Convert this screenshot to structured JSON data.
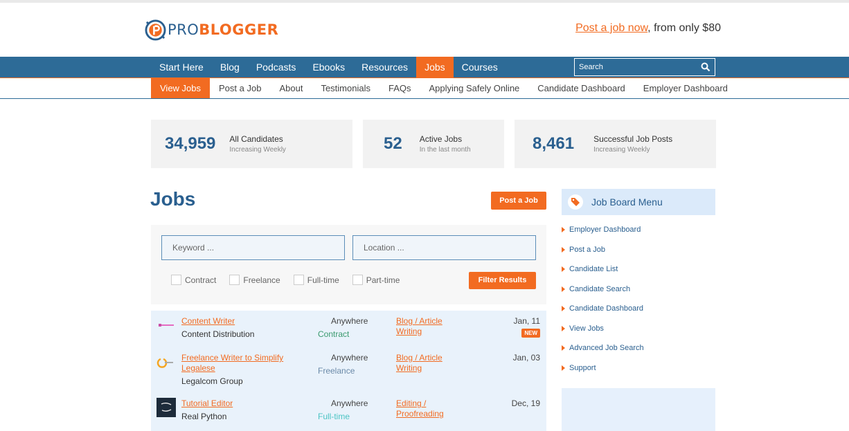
{
  "brand": {
    "logo_pro": "PRO",
    "logo_blogger": "BLOGGER",
    "colors": {
      "accent": "#f26b21",
      "primary": "#2d6b97",
      "heading": "#2a5f8f"
    }
  },
  "promo": {
    "link": "Post a job now",
    "rest": ", from only $80"
  },
  "nav": {
    "items": [
      {
        "label": "Start Here"
      },
      {
        "label": "Blog"
      },
      {
        "label": "Podcasts"
      },
      {
        "label": "Ebooks"
      },
      {
        "label": "Resources"
      },
      {
        "label": "Jobs",
        "active": true
      },
      {
        "label": "Courses"
      }
    ],
    "search_placeholder": "Search"
  },
  "subnav": {
    "items": [
      {
        "label": "View Jobs",
        "active": true
      },
      {
        "label": "Post a Job"
      },
      {
        "label": "About"
      },
      {
        "label": "Testimonials"
      },
      {
        "label": "FAQs"
      },
      {
        "label": "Applying Safely Online"
      },
      {
        "label": "Candidate Dashboard"
      },
      {
        "label": "Employer Dashboard"
      }
    ]
  },
  "stats": [
    {
      "number": "34,959",
      "title": "All Candidates",
      "sub": "Increasing Weekly"
    },
    {
      "number": "52",
      "title": "Active Jobs",
      "sub": "In the last month"
    },
    {
      "number": "8,461",
      "title": "Successful Job Posts",
      "sub": "Increasing Weekly"
    }
  ],
  "jobs": {
    "title": "Jobs",
    "post_button": "Post a Job",
    "filter": {
      "keyword_placeholder": "Keyword ...",
      "location_placeholder": "Location ...",
      "types": [
        "Contract",
        "Freelance",
        "Full-time",
        "Part-time"
      ],
      "button": "Filter Results"
    },
    "list": [
      {
        "title": "Content Writer",
        "company": "Content Distribution",
        "location": "Anywhere",
        "type": "Contract",
        "type_color": "#3a9a6e",
        "category": "Blog / Article Writing",
        "date": "Jan, 11",
        "badge": "NEW",
        "logo": "content-distribution-logo"
      },
      {
        "title": "Freelance Writer to Simplify Legalese",
        "company": "Legalcom Group",
        "location": "Anywhere",
        "type": "Freelance",
        "type_color": "#6b8aa8",
        "category": "Blog / Article Writing",
        "date": "Jan, 03",
        "badge": "",
        "logo": "legalcom-logo"
      },
      {
        "title": "Tutorial Editor",
        "company": "Real Python",
        "location": "Anywhere",
        "type": "Full-time",
        "type_color": "#4cc4c4",
        "category": "Editing / Proofreading",
        "date": "Dec, 19",
        "badge": "",
        "logo": "real-python-logo"
      }
    ]
  },
  "sidebar": {
    "title": "Job Board Menu",
    "icon": "tag-icon",
    "links": [
      "Employer Dashboard",
      "Post a Job",
      "Candidate List",
      "Candidate Search",
      "Candidate Dashboard",
      "View Jobs",
      "Advanced Job Search",
      "Support"
    ]
  }
}
